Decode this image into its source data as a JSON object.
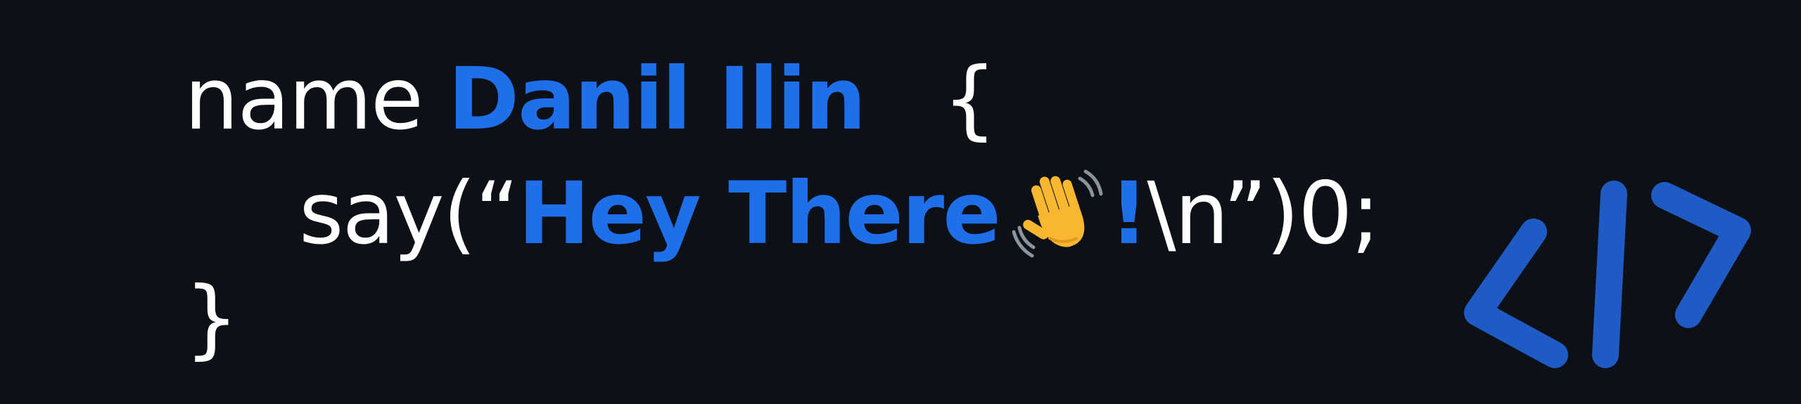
{
  "code": {
    "line1": {
      "keyword": "name",
      "name": "Danil Ilin",
      "brace": "{"
    },
    "line2": {
      "call_open": "say(“",
      "greeting": "Hey There",
      "emoji_icon": "waving-hand-icon",
      "exclaim": "!",
      "call_close": "\\n”)0;"
    },
    "line3": {
      "brace": "}"
    }
  },
  "logo": {
    "icon": "code-brackets-icon"
  },
  "colors": {
    "background": "#0d1117",
    "text": "#ffffff",
    "accent": "#1f6feb",
    "logo": "#1f5bc4"
  }
}
